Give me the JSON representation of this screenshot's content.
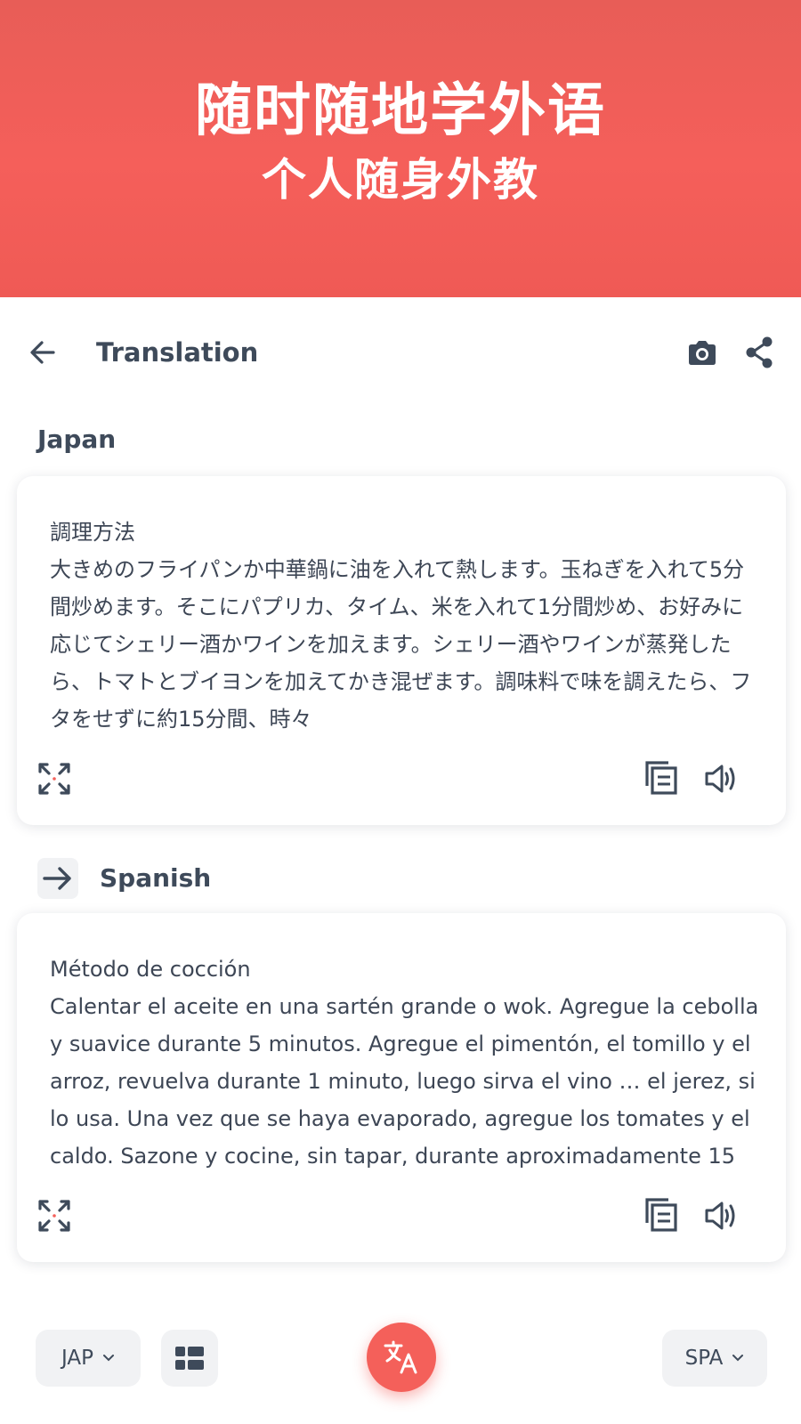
{
  "banner": {
    "line1": "随时随地学外语",
    "line2": "个人随身外教"
  },
  "header": {
    "title": "Translation",
    "back_icon": "arrow-left-icon",
    "camera_icon": "camera-icon",
    "share_icon": "share-icon"
  },
  "source": {
    "language": "Japan",
    "heading": "調理方法",
    "text": "大きめのフライパンか中華鍋に油を入れて熱します。玉ねぎを入れて5分間炒めます。そこにパプリカ、タイム、米を入れて1分間炒め、お好みに応じてシェリー酒かワインを加えます。シェリー酒やワインが蒸発したら、トマトとブイヨンを加えてかき混ぜます。調味料で味を調えたら、フタをせずに約15分間、時々"
  },
  "target": {
    "language": "Spanish",
    "heading": "Método de cocción",
    "text": "Calentar el aceite en una sartén grande o wok. Agregue la cebolla y suavice durante 5 minutos. Agregue el pimentón, el tomillo y el arroz, revuelva durante 1 minuto, luego sirva el vino … el jerez, si lo usa. Una vez que se haya evaporado, agregue los tomates y el caldo. Sazone y cocine, sin tapar, durante aproximadamente 15"
  },
  "bottom_bar": {
    "source_lang_code": "JAP",
    "target_lang_code": "SPA"
  },
  "colors": {
    "accent": "#f4605a",
    "text": "#3e4a5a",
    "chip_bg": "#f1f2f4"
  }
}
